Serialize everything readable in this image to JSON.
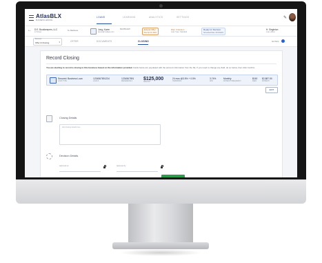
{
  "app": {
    "logo": "AtlasBLX",
    "logo_subtitle": "BUSINESS LENDING",
    "nav": [
      "LOANS",
      "LEARNING",
      "ANALYTICS",
      "SETTINGS"
    ],
    "active_nav": "LOANS"
  },
  "infobar": {
    "business_name": "D.E. Bookkeepers, LLC",
    "business_sub": "14 Street",
    "location": "St. Matthews",
    "contact_name": "Jung, Karen",
    "contact_phone": "502-555-0187",
    "contact_email": "jkaren@mailapp.com",
    "chip_offer": "Extend Offer",
    "chip_offer_sub": "Due Apr 10, 2021",
    "chip_risk": "Risk: 0 Medium",
    "chip_risk_sub": "Loan Type: Standard",
    "chip_status": "Ready for Decision",
    "chip_status_sub": "Scheduled Date: 04/13/2021",
    "officer": "H. Singleton",
    "officer_sub": "Loan officer"
  },
  "tabs": {
    "select_label": "Business",
    "select_value": "Offer & Closing",
    "items": [
      "OFFER",
      "DOCUMENTS",
      "CLOSING"
    ],
    "active": "CLOSING",
    "notes": "NOTES"
  },
  "card": {
    "title": "Record Closing",
    "desc_bold": "You are electing to record a closing to this business based on the information provided.",
    "desc_rest": "Fields below are populated with the account information from the file. If you need to change any field, do so below, then click Confirm.",
    "loan": {
      "name": "Secured: Business Loan",
      "name_sub": "LOAN TYPE",
      "number": "1234567891234",
      "number_sub": "LOAN #",
      "id2": "1234567891",
      "id2_sub": "REFERENCE #",
      "amount": "$125,000",
      "amount_sub": "AMOUNT",
      "term": "24 mos @3.5% + 0.5%",
      "term_sub": "TERM/RATE",
      "rate": "3.74%",
      "rate_sub": "APR",
      "frequency": "Monthly",
      "frequency_sub": "PAYMENT FREQUENCY",
      "fee": "$150",
      "fee_sub": "FEES",
      "payment": "$2,887.50",
      "payment_sub": "PAYMENT"
    },
    "edit_label": "EDIT",
    "closing_details_title": "Closing Details",
    "closing_placeholder": "Add closing details here",
    "decision_details_title": "Decision Details",
    "field1_label": "Approved on",
    "field2_label": "Approved by"
  }
}
